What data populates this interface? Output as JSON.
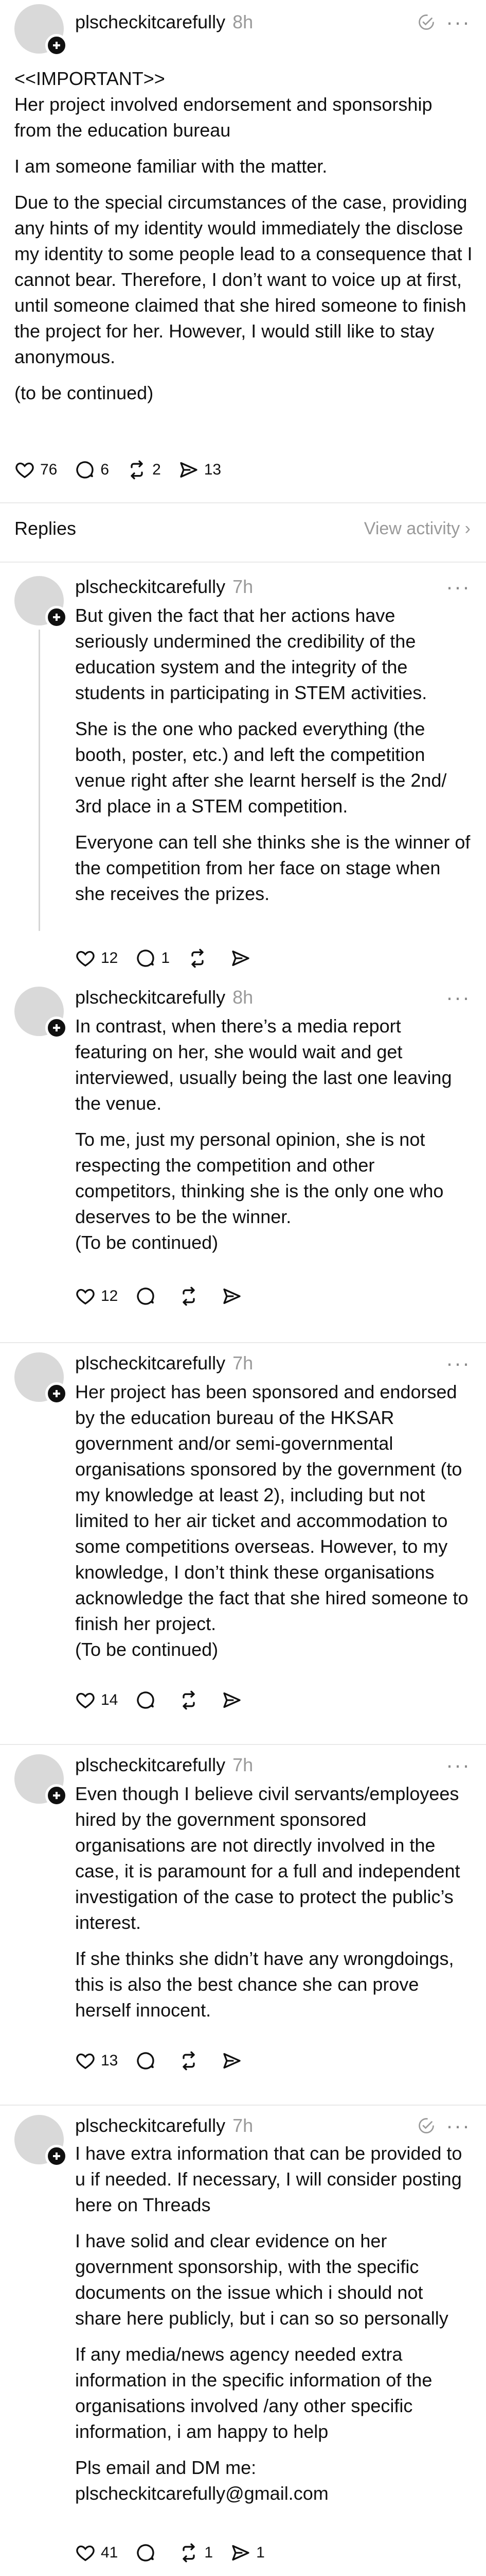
{
  "op": {
    "username": "plscheckitcarefully",
    "time": "8h",
    "paragraphs": [
      "<<IMPORTANT>>\nHer project involved endorsement and sponsorship from the education bureau",
      "I am someone familiar with the matter.",
      "Due to the special circumstances of the case, providing any hints of my identity would immediately the disclose my identity to some people lead to a consequence that I cannot bear. Therefore, I don’t want to voice up at first, until someone claimed that she hired someone to finish the project for her. However, I would still like to stay anonymous.",
      "(to be continued)"
    ],
    "likes": "76",
    "comments": "6",
    "reposts": "2",
    "shares": "13"
  },
  "replies_bar": {
    "title": "Replies",
    "view_activity": "View activity ›"
  },
  "replies": [
    {
      "username": "plscheckitcarefully",
      "time": "7h",
      "paragraphs": [
        "But given the fact that her actions have seriously undermined the credibility of the education system and the integrity of the students in participating in STEM activities.",
        "She is the one who packed everything (the booth, poster, etc.) and left the competition venue right after she learnt herself is the 2nd/ 3rd place in a STEM competition.",
        "Everyone can tell she thinks she is the winner of the competition from her face on stage when she receives the prizes."
      ],
      "likes": "12",
      "comments": "1"
    },
    {
      "username": "plscheckitcarefully",
      "time": "8h",
      "paragraphs": [
        "In contrast, when there’s a media report featuring on her, she would wait and get interviewed, usually being the last one leaving the venue.",
        "To me, just my personal opinion, she is not respecting the competition and other competitors, thinking she is the only one who deserves to be the winner.\n(To be continued)"
      ],
      "likes": "12"
    },
    {
      "username": "plscheckitcarefully",
      "time": "7h",
      "paragraphs": [
        "Her project has been sponsored and endorsed by the education bureau of the HKSAR government and/or semi-governmental organisations sponsored by the government (to my knowledge at least 2), including but not limited to her air ticket and accommodation to some competitions overseas. However, to my knowledge, I don’t think these organisations acknowledge the fact that she hired someone to finish her project.\n(To be continued)"
      ],
      "likes": "14"
    },
    {
      "username": "plscheckitcarefully",
      "time": "7h",
      "paragraphs": [
        "Even though I believe civil servants/employees hired by the government sponsored organisations are not directly involved in the case, it is paramount for a full and independent investigation of the case to protect the public’s interest.",
        "If she thinks she didn’t have any wrongdoings, this is also the best chance she can prove herself innocent."
      ],
      "likes": "13"
    },
    {
      "username": "plscheckitcarefully",
      "time": "7h",
      "paragraphs": [
        "I have extra information that can be provided to u if needed. If necessary, I will consider posting here on Threads",
        "I have solid and clear evidence on her government sponsorship, with the specific documents on the issue which i should not share here publicly, but i can so so personally",
        "If any media/news agency needed extra information in the specific information of the organisations involved /any other specific information, i am happy to help",
        "Pls email and DM me:\nplscheckitcarefully@gmail.com"
      ],
      "likes": "41",
      "reposts": "1",
      "shares": "1"
    }
  ],
  "icons": {
    "like": "heart-icon",
    "comment": "comment-icon",
    "repost": "repost-icon",
    "share": "send-icon",
    "more": "more-icon",
    "check": "check-badge-icon"
  },
  "colors": {
    "text": "#101010",
    "muted": "#9a9a9a",
    "line": "#d6d6d6"
  }
}
